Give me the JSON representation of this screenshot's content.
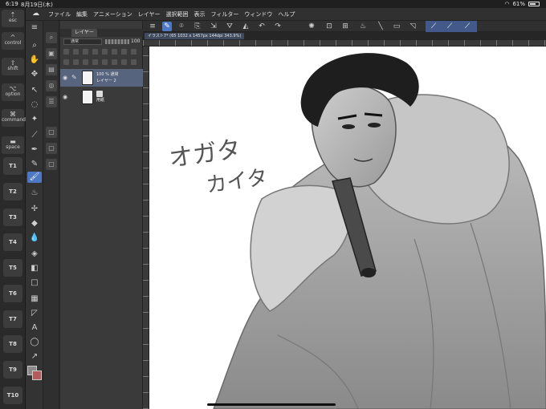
{
  "status_bar": {
    "time": "6:19",
    "date": "8月19日(木)",
    "battery": "61%"
  },
  "key_strip": {
    "modifiers": [
      {
        "label": "esc",
        "icon": "cloud-icon"
      },
      {
        "label": "control",
        "icon": "caret-icon"
      },
      {
        "label": "shift",
        "icon": "shift-arrow-icon"
      },
      {
        "label": "option",
        "icon": "option-icon"
      },
      {
        "label": "command",
        "icon": "command-icon"
      },
      {
        "label": "space",
        "icon": "space-bar-icon"
      }
    ],
    "tkeys": [
      "T1",
      "T2",
      "T3",
      "T4",
      "T5",
      "T6",
      "T7",
      "T8",
      "T9",
      "T10"
    ]
  },
  "menubar": {
    "items": [
      "ファイル",
      "編集",
      "アニメーション",
      "レイヤー",
      "選択範囲",
      "表示",
      "フィルター",
      "ウィンドウ",
      "ヘルプ"
    ]
  },
  "layer_panel": {
    "tab_label": "レイヤー",
    "blend_mode": "通常",
    "opacity": "100",
    "layers": [
      {
        "line1": "100 % 通常",
        "line2": "レイヤー 2",
        "selected": true
      },
      {
        "line1": "",
        "line2": "用紙",
        "selected": false
      }
    ]
  },
  "document": {
    "tab_title": "イラスト7* (65 1032 x 1457px 144dpi 343.9%)"
  },
  "canvas": {
    "handwriting_line1": "オガタ",
    "handwriting_line2": "カイタ"
  }
}
